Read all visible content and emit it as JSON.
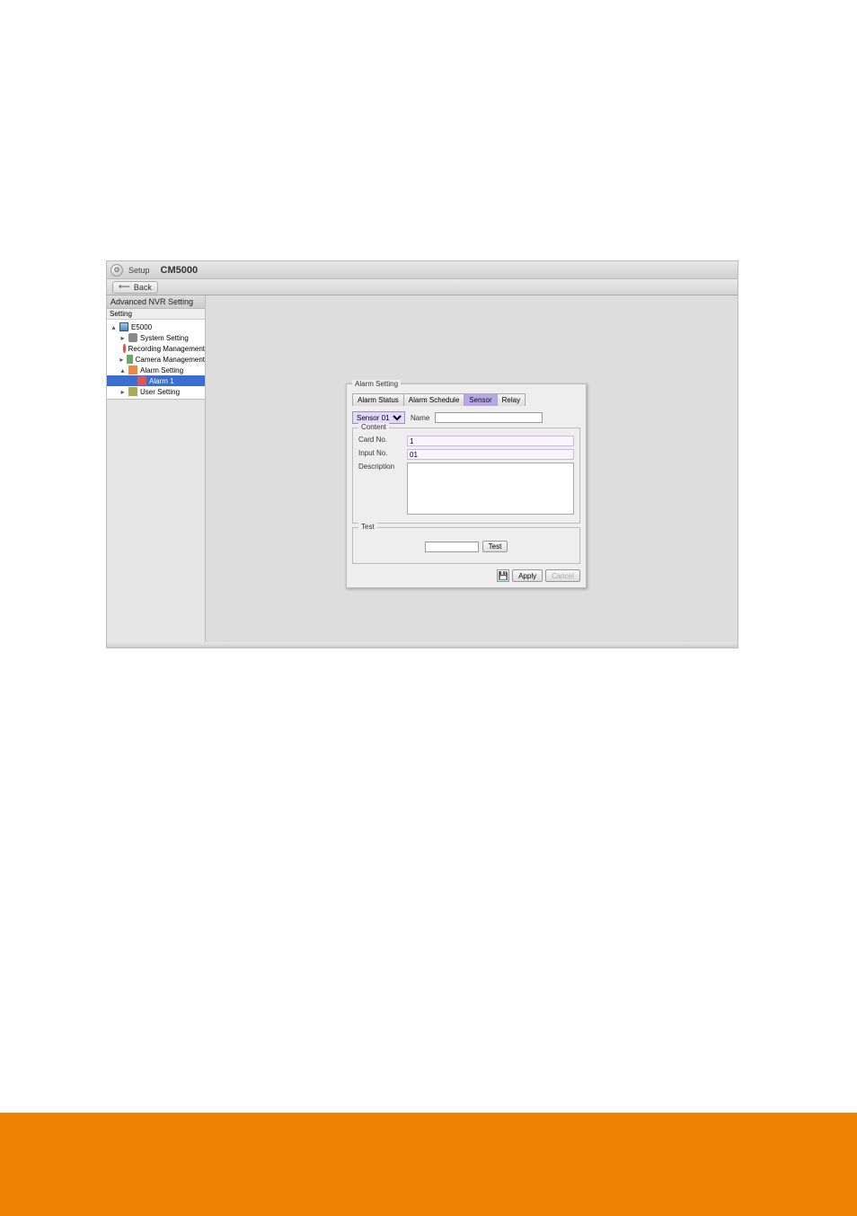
{
  "titlebar": {
    "setup_label": "Setup",
    "product_name": "CM5000"
  },
  "toolbar": {
    "back_label": "Back"
  },
  "sidebar": {
    "header": "Advanced NVR Setting",
    "panel_title": "Setting",
    "tree": {
      "root": "E5000",
      "items": [
        "System Setting",
        "Recording Management",
        "Camera Management",
        "Alarm Setting",
        "User Setting"
      ],
      "alarm_children": [
        "Alarm 1"
      ]
    }
  },
  "alarm_panel": {
    "title": "Alarm Setting",
    "tabs": [
      "Alarm Status",
      "Alarm Schedule",
      "Sensor",
      "Relay"
    ],
    "active_tab": 2,
    "sensor_select": "Sensor 01",
    "name_label": "Name",
    "name_value": "",
    "content": {
      "title": "Content",
      "card_no_label": "Card No.",
      "card_no_value": "1",
      "input_no_label": "Input No.",
      "input_no_value": "01",
      "description_label": "Description",
      "description_value": ""
    },
    "test": {
      "title": "Test",
      "input_value": "",
      "button_label": "Test"
    },
    "buttons": {
      "apply": "Apply",
      "cancel": "Cancel"
    }
  }
}
